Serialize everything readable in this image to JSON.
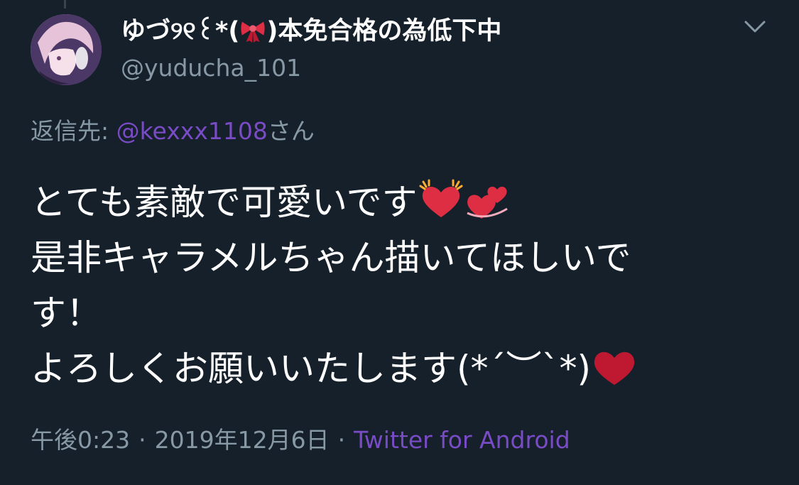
{
  "colors": {
    "background": "#15202b",
    "secondary_text": "#8899a6",
    "accent_link": "#794bc4",
    "heart_red": "#dd2e44"
  },
  "tweet": {
    "author": {
      "name_prefix": "ゆづ୨୧꒰",
      "name_mid": "*(",
      "name_suffix": ")本免合格の為低下中",
      "ribbon_icon": "ribbon-emoji",
      "handle": "@yuducha_101"
    },
    "menu_icon": "chevron-down-icon",
    "reply": {
      "prefix": "返信先: ",
      "user": "@kexxx1108",
      "suffix": "さん"
    },
    "body": {
      "line1": "とても素敵で可愛いです",
      "line1_emoji": [
        "beating-heart-emoji",
        "two-hearts-emoji"
      ],
      "line2": "是非キャラメルちゃん描いてほしいで",
      "line3": "す！",
      "line4": "よろしくお願いいたします(*´︶`*)",
      "line4_emoji": [
        "red-heart-emoji"
      ]
    },
    "meta": {
      "time": "午後0:23",
      "separator1": "·",
      "date": "2019年12月6日",
      "separator2": "·",
      "source": "Twitter for Android"
    }
  }
}
